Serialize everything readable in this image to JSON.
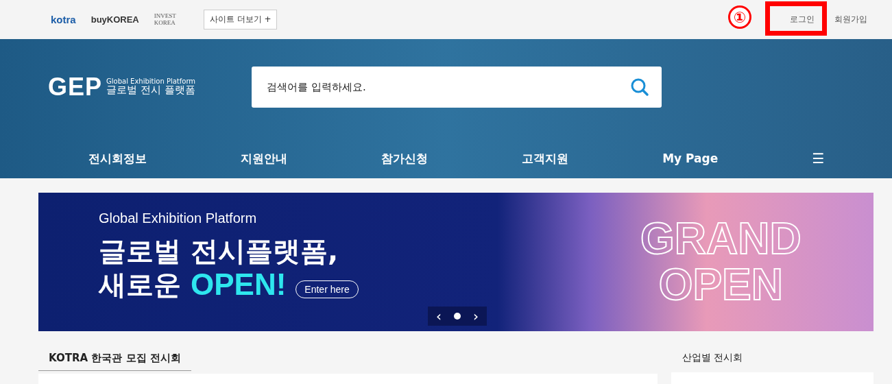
{
  "annotation": {
    "number": "①"
  },
  "top_bar": {
    "logos": [
      {
        "kind": "kotra",
        "text": "kotra"
      },
      {
        "kind": "buykorea",
        "text": "buyKOREA"
      },
      {
        "kind": "invest",
        "text": "INVEST KOREA"
      }
    ],
    "more_button": "사이트 더보기 +",
    "links": [
      "로그인",
      "회원가입"
    ]
  },
  "header": {
    "logo": {
      "mark": "GEP",
      "subtitle": "Global Exhibition Platform",
      "title": "글로벌 전시 플랫폼"
    },
    "search": {
      "placeholder": "검색어를 입력하세요."
    },
    "nav": [
      "전시회정보",
      "지원안내",
      "참가신청",
      "고객지원",
      "My Page"
    ],
    "menu_icon": "☰"
  },
  "banner": {
    "eyebrow": "Global Exhibition Platform",
    "headline_1": "글로벌 전시플랫폼,",
    "headline_2": "새로운",
    "headline_accent": "OPEN!",
    "button": "Enter here",
    "art_1": "GRAND",
    "art_2": "OPEN",
    "pager": {
      "prev": "‹",
      "next": "›",
      "dots": [
        {
          "selected": true
        }
      ]
    }
  },
  "sections": [
    {
      "title": "KOTRA 한국관 모집 전시회",
      "selected": true
    },
    {
      "title": "산업별 전시회",
      "selected": false
    }
  ]
}
